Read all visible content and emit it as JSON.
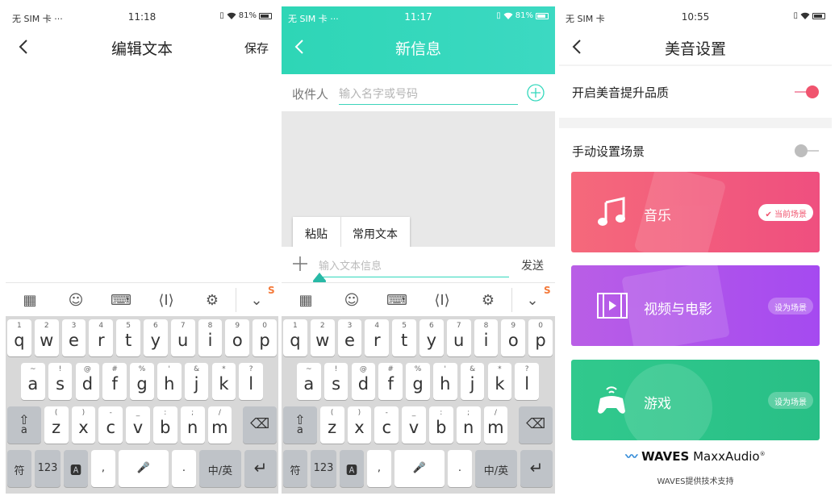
{
  "phone1": {
    "status": {
      "left": "无 SIM 卡 ···",
      "time": "11:18",
      "battery": "81%"
    },
    "title": "编辑文本",
    "save": "保存"
  },
  "phone2": {
    "status": {
      "left": "无 SIM 卡 ···",
      "time": "11:17",
      "battery": "81%"
    },
    "title": "新信息",
    "recipient_label": "收件人",
    "recipient_placeholder": "输入名字或号码",
    "popup": {
      "paste": "粘贴",
      "common": "常用文本"
    },
    "message_placeholder": "输入文本信息",
    "send": "发送"
  },
  "phone3": {
    "status": {
      "left": "无 SIM 卡",
      "time": "10:55"
    },
    "title": "美音设置",
    "enable_label": "开启美音提升品质",
    "enable_on": true,
    "manual_label": "手动设置场景",
    "manual_on": false,
    "scenes": [
      {
        "name": "音乐",
        "badge": "当前场景",
        "color": "#f25c78"
      },
      {
        "name": "视频与电影",
        "badge": "设为场景",
        "color": "#b454e9"
      },
      {
        "name": "游戏",
        "badge": "设为场景",
        "color": "#2ec48c"
      }
    ],
    "waves_brand": "WAVES",
    "waves_product": "MaxxAudio",
    "waves_support": "WAVES提供技术支持"
  },
  "keyboard": {
    "row1": [
      {
        "s": "1",
        "m": "q"
      },
      {
        "s": "2",
        "m": "w"
      },
      {
        "s": "3",
        "m": "e"
      },
      {
        "s": "4",
        "m": "r"
      },
      {
        "s": "5",
        "m": "t"
      },
      {
        "s": "6",
        "m": "y"
      },
      {
        "s": "7",
        "m": "u"
      },
      {
        "s": "8",
        "m": "i"
      },
      {
        "s": "9",
        "m": "o"
      },
      {
        "s": "0",
        "m": "p"
      }
    ],
    "row2": [
      {
        "s": "~",
        "m": "a"
      },
      {
        "s": "!",
        "m": "s"
      },
      {
        "s": "@",
        "m": "d"
      },
      {
        "s": "#",
        "m": "f"
      },
      {
        "s": "%",
        "m": "g"
      },
      {
        "s": "'",
        "m": "h"
      },
      {
        "s": "&",
        "m": "j"
      },
      {
        "s": "*",
        "m": "k"
      },
      {
        "s": "?",
        "m": "l"
      }
    ],
    "row3": [
      {
        "s": "(",
        "m": "z"
      },
      {
        "s": ")",
        "m": "x"
      },
      {
        "s": "-",
        "m": "c"
      },
      {
        "s": "_",
        "m": "v"
      },
      {
        "s": ":",
        "m": "b"
      },
      {
        "s": ";",
        "m": "n"
      },
      {
        "s": "/",
        "m": "m"
      }
    ],
    "shift_sub": "a",
    "fu": "符",
    "num": "123",
    "comma": ",",
    "period": ".",
    "lang": "中/英"
  },
  "colors": {
    "teal": "#32d8bc",
    "pink": "#f0546e",
    "toggle_off": "#bdbdbd"
  }
}
